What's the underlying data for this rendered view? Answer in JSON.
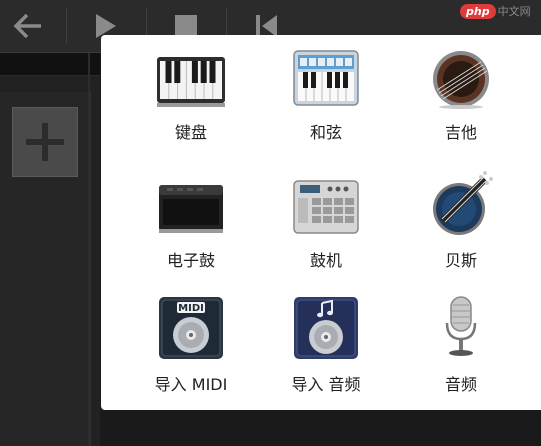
{
  "watermark": {
    "badge": "php",
    "text": "中文网"
  },
  "instruments": [
    {
      "label": "键盘",
      "icon": "piano-keyboard-icon"
    },
    {
      "label": "和弦",
      "icon": "chord-keyboard-icon"
    },
    {
      "label": "吉他",
      "icon": "guitar-icon"
    },
    {
      "label": "电子鼓",
      "icon": "drum-pad-icon"
    },
    {
      "label": "鼓机",
      "icon": "drum-machine-icon"
    },
    {
      "label": "贝斯",
      "icon": "bass-icon"
    },
    {
      "label": "导入 MIDI",
      "icon": "midi-disc-icon"
    },
    {
      "label": "导入 音频",
      "icon": "audio-disc-icon"
    },
    {
      "label": "音频",
      "icon": "microphone-icon"
    }
  ],
  "disc_labels": {
    "midi": "MIDI"
  },
  "colors": {
    "accent_red": "#e03b3b",
    "panel_bg": "#ffffff",
    "app_bg": "#1a1a1a"
  }
}
